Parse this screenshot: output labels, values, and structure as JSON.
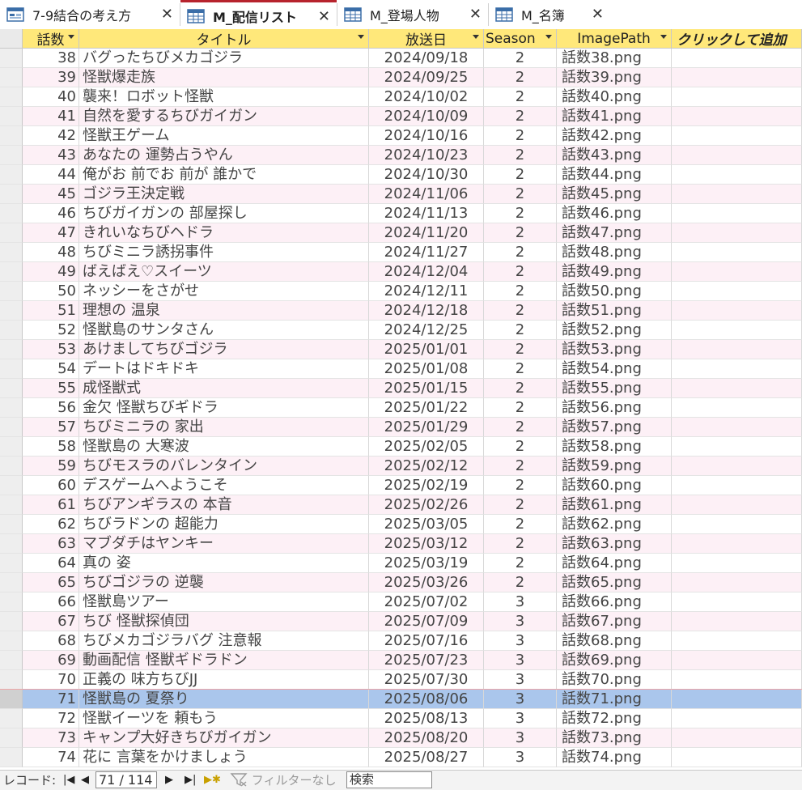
{
  "tabs": [
    {
      "label": "7-9結合の考え方",
      "icon": "form-icon",
      "active": false
    },
    {
      "label": "M_配信リスト",
      "icon": "table-icon",
      "active": true
    },
    {
      "label": "M_登場人物",
      "icon": "table-icon",
      "active": false
    },
    {
      "label": "M_名簿",
      "icon": "table-icon",
      "active": false
    }
  ],
  "columns": {
    "num": "話数",
    "title": "タイトル",
    "date": "放送日",
    "season": "Season",
    "image": "ImagePath",
    "add": "クリックして追加"
  },
  "rows": [
    {
      "num": "38",
      "title": "バグったちびメカゴジラ",
      "date": "2024/09/18",
      "season": "2",
      "image": "話数38.png"
    },
    {
      "num": "39",
      "title": "怪獣爆走族",
      "date": "2024/09/25",
      "season": "2",
      "image": "話数39.png"
    },
    {
      "num": "40",
      "title": "襲来！ロボット怪獣",
      "date": "2024/10/02",
      "season": "2",
      "image": "話数40.png"
    },
    {
      "num": "41",
      "title": "自然を愛するちびガイガン",
      "date": "2024/10/09",
      "season": "2",
      "image": "話数41.png"
    },
    {
      "num": "42",
      "title": "怪獣王ゲーム",
      "date": "2024/10/16",
      "season": "2",
      "image": "話数42.png"
    },
    {
      "num": "43",
      "title": "あなたの 運勢占うやん",
      "date": "2024/10/23",
      "season": "2",
      "image": "話数43.png"
    },
    {
      "num": "44",
      "title": "俺がお 前でお 前が 誰かで",
      "date": "2024/10/30",
      "season": "2",
      "image": "話数44.png"
    },
    {
      "num": "45",
      "title": "ゴジラ王決定戦",
      "date": "2024/11/06",
      "season": "2",
      "image": "話数45.png"
    },
    {
      "num": "46",
      "title": "ちびガイガンの 部屋探し",
      "date": "2024/11/13",
      "season": "2",
      "image": "話数46.png"
    },
    {
      "num": "47",
      "title": "きれいなちびヘドラ",
      "date": "2024/11/20",
      "season": "2",
      "image": "話数47.png"
    },
    {
      "num": "48",
      "title": "ちびミニラ誘拐事件",
      "date": "2024/11/27",
      "season": "2",
      "image": "話数48.png"
    },
    {
      "num": "49",
      "title": "ばえばえ♡スイーツ",
      "date": "2024/12/04",
      "season": "2",
      "image": "話数49.png"
    },
    {
      "num": "50",
      "title": "ネッシーをさがせ",
      "date": "2024/12/11",
      "season": "2",
      "image": "話数50.png"
    },
    {
      "num": "51",
      "title": "理想の 温泉",
      "date": "2024/12/18",
      "season": "2",
      "image": "話数51.png"
    },
    {
      "num": "52",
      "title": "怪獣島のサンタさん",
      "date": "2024/12/25",
      "season": "2",
      "image": "話数52.png"
    },
    {
      "num": "53",
      "title": "あけましてちびゴジラ",
      "date": "2025/01/01",
      "season": "2",
      "image": "話数53.png"
    },
    {
      "num": "54",
      "title": "デートはドキドキ",
      "date": "2025/01/08",
      "season": "2",
      "image": "話数54.png"
    },
    {
      "num": "55",
      "title": "成怪獣式",
      "date": "2025/01/15",
      "season": "2",
      "image": "話数55.png"
    },
    {
      "num": "56",
      "title": "金欠 怪獣ちびギドラ",
      "date": "2025/01/22",
      "season": "2",
      "image": "話数56.png"
    },
    {
      "num": "57",
      "title": "ちびミニラの 家出",
      "date": "2025/01/29",
      "season": "2",
      "image": "話数57.png"
    },
    {
      "num": "58",
      "title": "怪獣島の 大寒波",
      "date": "2025/02/05",
      "season": "2",
      "image": "話数58.png"
    },
    {
      "num": "59",
      "title": "ちびモスラのバレンタイン",
      "date": "2025/02/12",
      "season": "2",
      "image": "話数59.png"
    },
    {
      "num": "60",
      "title": "デスゲームへようこそ",
      "date": "2025/02/19",
      "season": "2",
      "image": "話数60.png"
    },
    {
      "num": "61",
      "title": "ちびアンギラスの 本音",
      "date": "2025/02/26",
      "season": "2",
      "image": "話数61.png"
    },
    {
      "num": "62",
      "title": "ちびラドンの 超能力",
      "date": "2025/03/05",
      "season": "2",
      "image": "話数62.png"
    },
    {
      "num": "63",
      "title": "マブダチはヤンキー",
      "date": "2025/03/12",
      "season": "2",
      "image": "話数63.png"
    },
    {
      "num": "64",
      "title": "真の 姿",
      "date": "2025/03/19",
      "season": "2",
      "image": "話数64.png"
    },
    {
      "num": "65",
      "title": "ちびゴジラの 逆襲",
      "date": "2025/03/26",
      "season": "2",
      "image": "話数65.png"
    },
    {
      "num": "66",
      "title": "怪獣島ツアー",
      "date": "2025/07/02",
      "season": "3",
      "image": "話数66.png"
    },
    {
      "num": "67",
      "title": "ちび 怪獣探偵団",
      "date": "2025/07/09",
      "season": "3",
      "image": "話数67.png"
    },
    {
      "num": "68",
      "title": "ちびメカゴジラバグ 注意報",
      "date": "2025/07/16",
      "season": "3",
      "image": "話数68.png"
    },
    {
      "num": "69",
      "title": "動画配信 怪獣ギドラドン",
      "date": "2025/07/23",
      "season": "3",
      "image": "話数69.png"
    },
    {
      "num": "70",
      "title": "正義の 味方ちびJJ",
      "date": "2025/07/30",
      "season": "3",
      "image": "話数70.png"
    },
    {
      "num": "71",
      "title": "怪獣島の 夏祭り",
      "date": "2025/08/06",
      "season": "3",
      "image": "話数71.png",
      "selected": true
    },
    {
      "num": "72",
      "title": "怪獣イーツを 頼もう",
      "date": "2025/08/13",
      "season": "3",
      "image": "話数72.png"
    },
    {
      "num": "73",
      "title": "キャンプ大好きちびガイガン",
      "date": "2025/08/20",
      "season": "3",
      "image": "話数73.png"
    },
    {
      "num": "74",
      "title": "花に 言葉をかけましょう",
      "date": "2025/08/27",
      "season": "3",
      "image": "話数74.png"
    }
  ],
  "status": {
    "record_label": "レコード:",
    "record_value": "71 / 114",
    "filter_label": "フィルターなし",
    "search_value": "検索"
  },
  "colors": {
    "header_bg": "#ffe87a",
    "selected_row": "#aac6ec",
    "alt_row": "#fdf0f6",
    "active_tab_accent": "#b7232d"
  }
}
